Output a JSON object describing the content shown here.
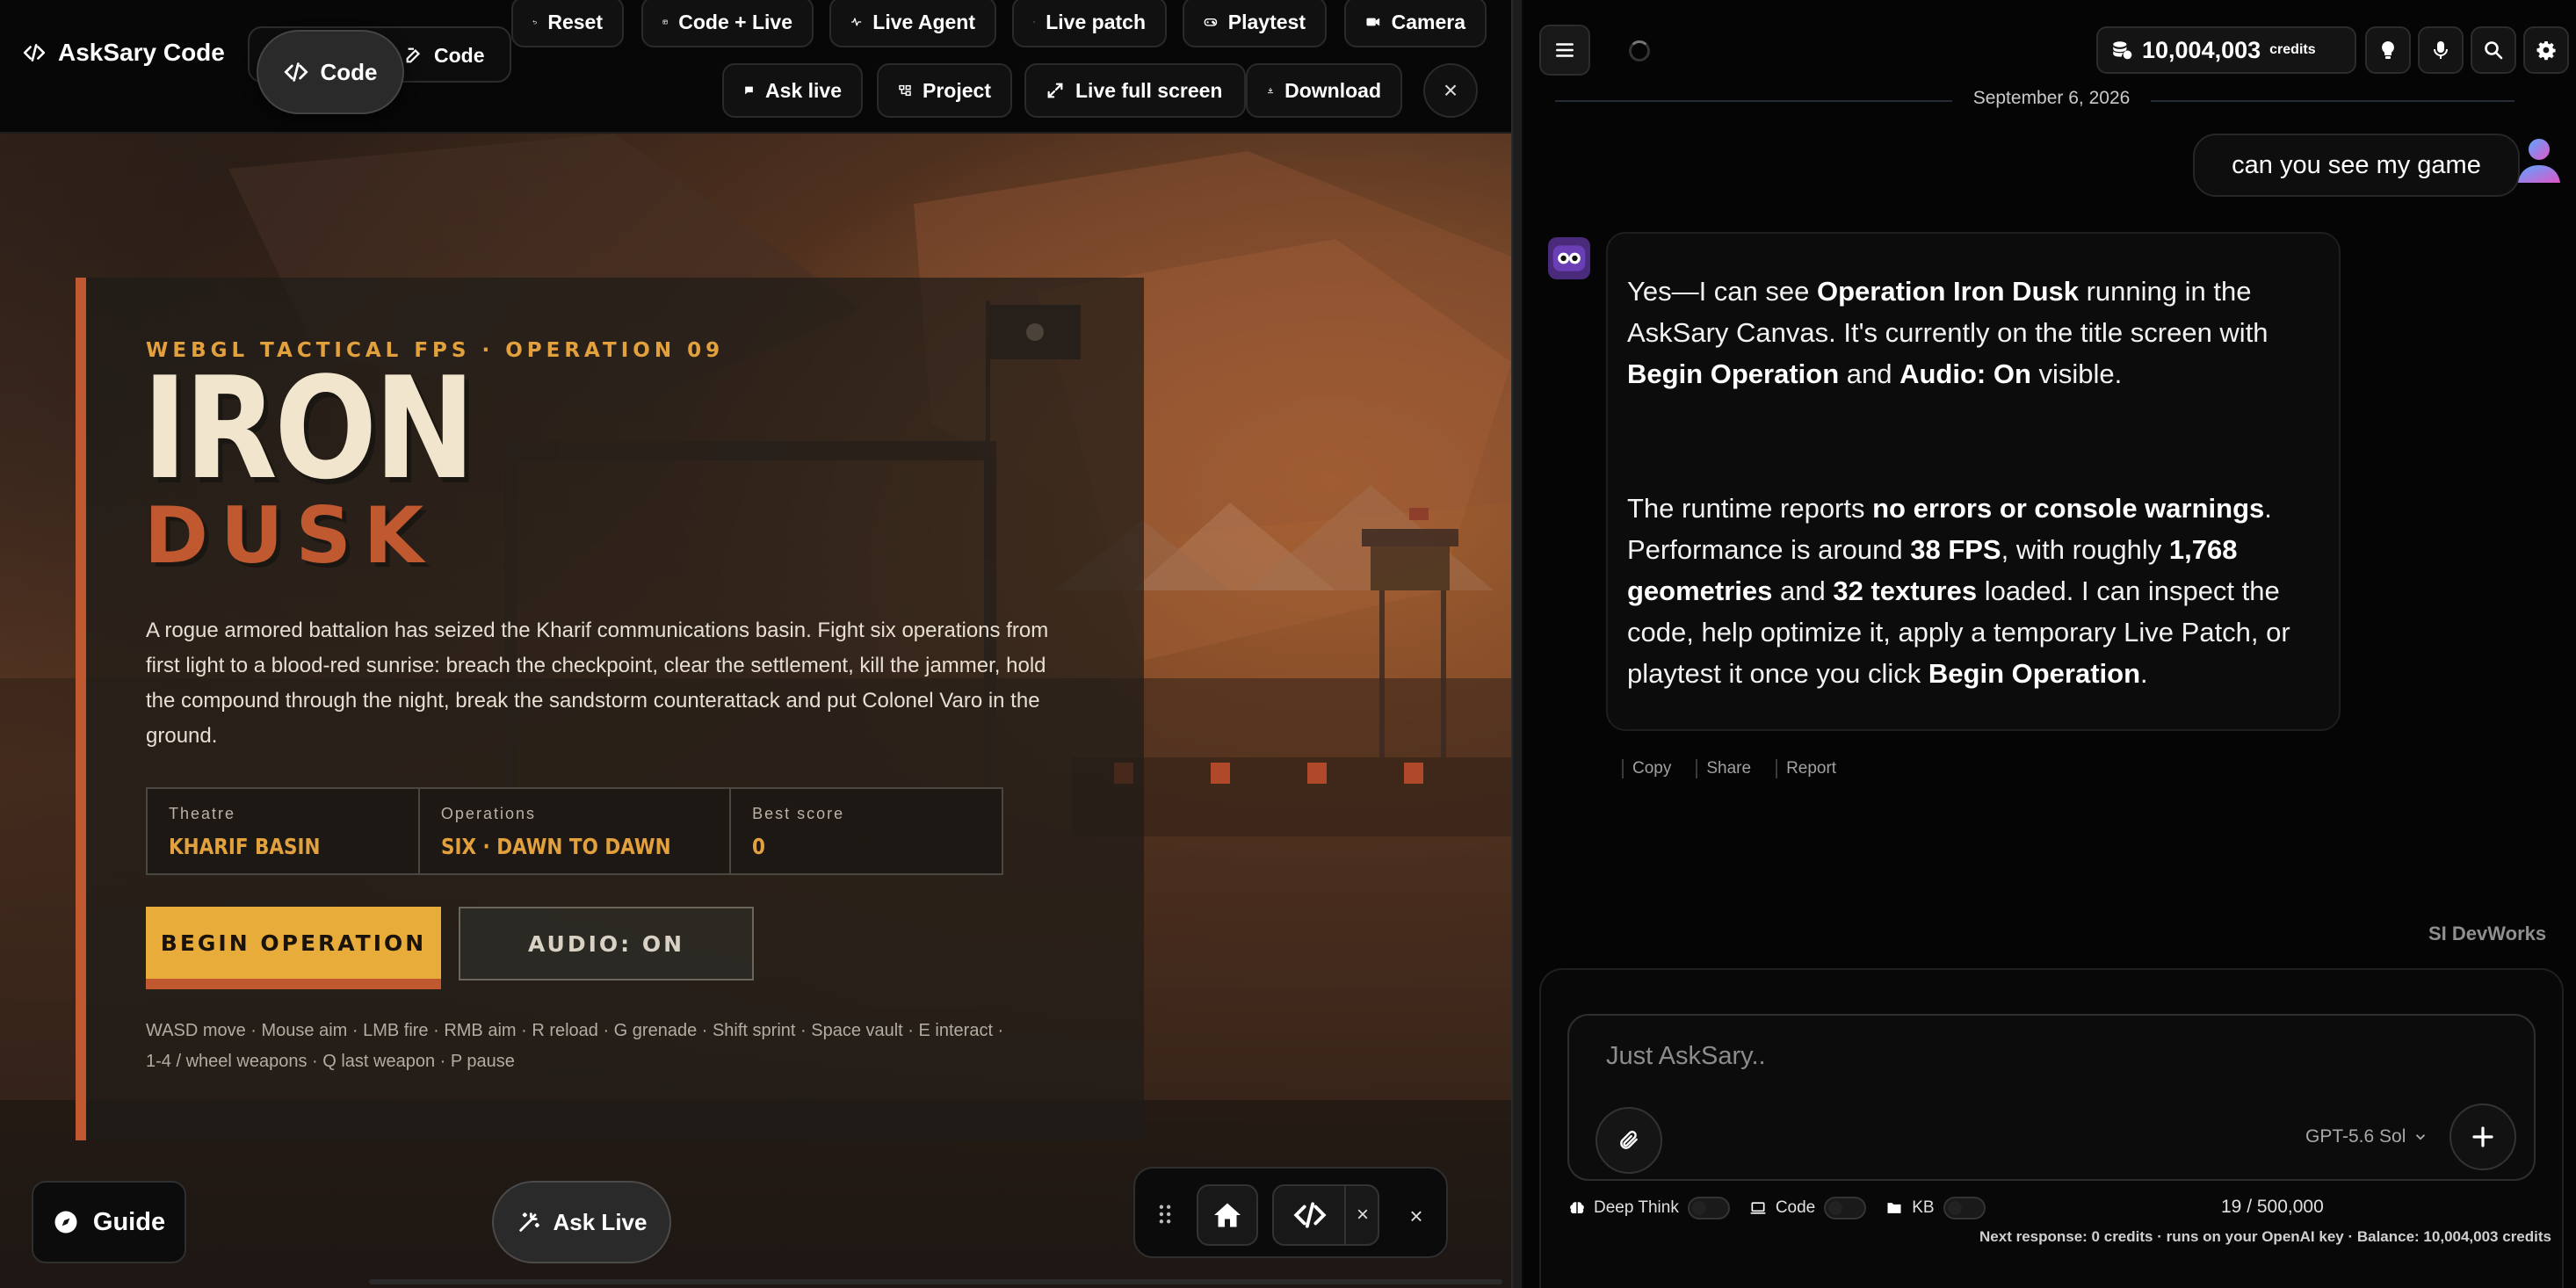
{
  "app": {
    "name": "AskSary Code"
  },
  "toolbar": {
    "code_toggle_left": "Code",
    "code_toggle_right": "Code",
    "reset": "Reset",
    "code_live": "Code + Live",
    "live_agent": "Live Agent",
    "live_patch": "Live patch",
    "playtest": "Playtest",
    "camera": "Camera",
    "ask_live": "Ask live",
    "project": "Project",
    "live_full_screen": "Live full screen",
    "download": "Download",
    "close": "×"
  },
  "game": {
    "eyebrow": "WEBGL TACTICAL FPS · OPERATION 09",
    "title_line1": "IRON",
    "title_line2": "DUSK",
    "description": "A rogue armored battalion has seized the Kharif communications basin. Fight six operations from first light to a blood-red sunrise: breach the checkpoint, clear the settlement, kill the jammer, hold the compound through the night, break the sandstorm counterattack and put Colonel Varo in the ground.",
    "stats": [
      {
        "label": "Theatre",
        "value": "KHARIF BASIN"
      },
      {
        "label": "Operations",
        "value": "SIX · DAWN TO DAWN"
      },
      {
        "label": "Best score",
        "value": "0"
      }
    ],
    "begin_button": "BEGIN OPERATION",
    "audio_button": "AUDIO: ON",
    "controls_line1": "WASD move · Mouse aim · LMB fire · RMB aim · R reload · G grenade · Shift sprint · Space vault · E interact ·",
    "controls_line2": "1-4 / wheel weapons · Q last weapon · P pause"
  },
  "bottom": {
    "guide": "Guide",
    "ask_live": "Ask Live",
    "dock_close_small": "×",
    "dock_close": "×"
  },
  "chat": {
    "credits_value": "10,004,003",
    "credits_unit": "credits",
    "date": "September 6, 2026",
    "user_message": "can you see my game",
    "reply": {
      "p1": [
        {
          "t": "Yes—I can see ",
          "b": false
        },
        {
          "t": "Operation Iron Dusk",
          "b": true
        },
        {
          "t": " running in the AskSary Canvas. It's currently on the title screen with ",
          "b": false
        },
        {
          "t": "Begin Operation",
          "b": true
        },
        {
          "t": " and ",
          "b": false
        },
        {
          "t": "Audio: On",
          "b": true
        },
        {
          "t": " visible.",
          "b": false
        }
      ],
      "p2": [
        {
          "t": "The runtime reports ",
          "b": false
        },
        {
          "t": "no errors or console warnings",
          "b": true
        },
        {
          "t": ". Performance is around ",
          "b": false
        },
        {
          "t": "38 FPS",
          "b": true
        },
        {
          "t": ", with roughly ",
          "b": false
        },
        {
          "t": "1,768 geometries",
          "b": true
        },
        {
          "t": " and ",
          "b": false
        },
        {
          "t": "32 textures",
          "b": true
        },
        {
          "t": " loaded. I can inspect the code, help optimize it, apply a temporary Live Patch, or playtest it once you click ",
          "b": false
        },
        {
          "t": "Begin Operation",
          "b": true
        },
        {
          "t": ".",
          "b": false
        }
      ]
    },
    "actions": [
      "Copy",
      "Share",
      "Report"
    ],
    "brand": "SI DevWorks",
    "input_placeholder": "Just AskSary..",
    "model": "GPT-5.6 Sol",
    "toggles": [
      "Deep Think",
      "Code",
      "KB"
    ],
    "char_count": "19 / 500,000",
    "footer": "Next response: 0 credits · runs on your OpenAI key · Balance: 10,004,003 credits"
  },
  "colors": {
    "accent_orange": "#e8ac3a",
    "accent_red": "#c0592f",
    "cream": "#f1e6cd",
    "bg_dark": "#050505"
  }
}
